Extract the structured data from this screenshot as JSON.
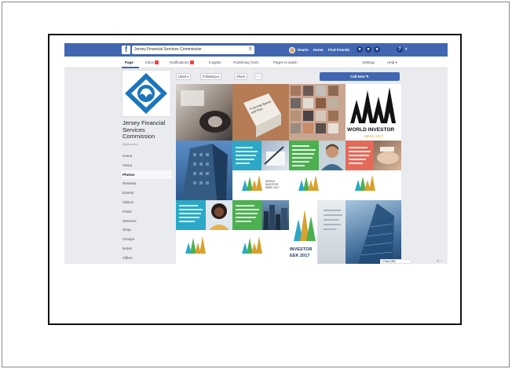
{
  "topbar": {
    "logo": "f",
    "search_value": "Jersey Financial Services Commission",
    "user_name": "Dearie",
    "home": "Home",
    "find_friends": "Find Friends",
    "help": "?"
  },
  "tabs": [
    {
      "label": "Page"
    },
    {
      "label": "Inbox"
    },
    {
      "label": "Notifications"
    },
    {
      "label": "Insights"
    },
    {
      "label": "Publishing Tools"
    },
    {
      "label": "Pages to watch"
    },
    {
      "label": "Settings"
    },
    {
      "label": "Help ▾"
    }
  ],
  "page": {
    "name": "Jersey Financial Services Commission",
    "handle": "@jerseyfsc"
  },
  "left_menu": [
    "Home",
    "About",
    "Photos",
    "Reviews",
    "Events",
    "Videos",
    "Posts",
    "Services",
    "Shop",
    "Groups",
    "Notes",
    "Offers"
  ],
  "left_menu_active": "Photos",
  "actions": {
    "liked": "Liked ▾",
    "following": "Following ▾",
    "share": "Share",
    "more": "···",
    "call_now": "Call Now ✎"
  },
  "tiles": {
    "world_investor_title": "WORLD INVESTOR",
    "world_investor_sub": "WEEK 2017",
    "world_investor_small_1": "WORLD",
    "world_investor_small_2": "INVESTOR",
    "world_investor_small_3": "WEEK 2017",
    "investor_week_1": "INVESTOR",
    "investor_week_2": "EEK 2017",
    "note_card": "A Saving Spend and Plan"
  },
  "chat": {
    "label": "Chat (Off)"
  },
  "colors": {
    "facebook_blue": "#4267b2",
    "investor_green": "#4caf50",
    "investor_teal": "#2ba8c7",
    "logo_blue": "#1b75bb"
  }
}
